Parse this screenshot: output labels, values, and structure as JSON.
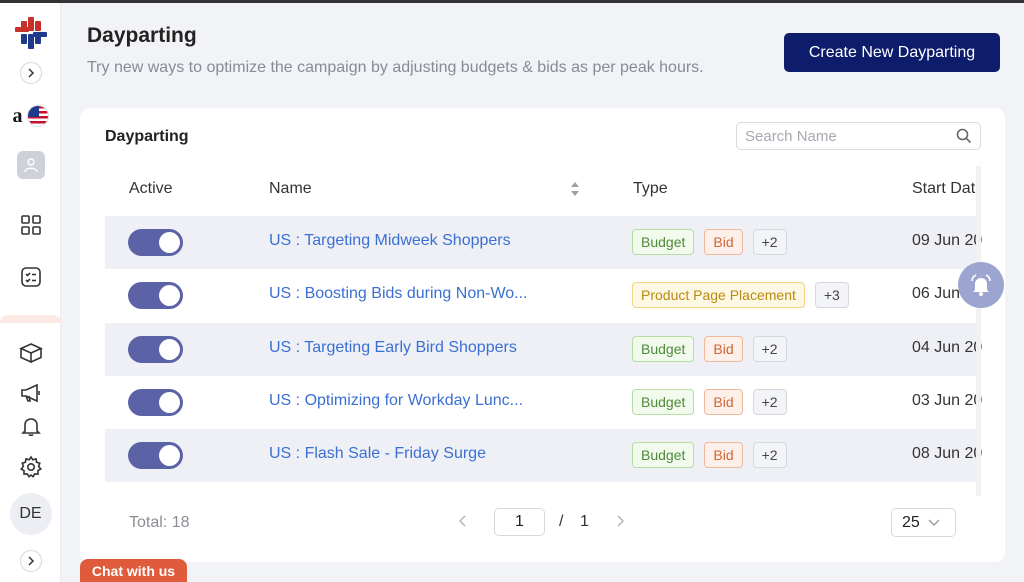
{
  "header": {
    "title": "Dayparting",
    "subtitle": "Try new ways to optimize the campaign by adjusting budgets & bids as per peak hours.",
    "create_button": "Create New Dayparting"
  },
  "sidebar": {
    "marketplace_letter": "a",
    "user_initials": "DE",
    "icons": [
      "logo-icon",
      "expand-icon",
      "amazon-icon",
      "us-flag-icon",
      "user-icon",
      "dashboard-icon",
      "checklist-icon",
      "box-icon",
      "megaphone-icon",
      "bell-icon",
      "gear-icon",
      "expand-icon"
    ]
  },
  "card": {
    "title": "Dayparting",
    "search": {
      "placeholder": "Search Name",
      "value": ""
    }
  },
  "table": {
    "columns": {
      "active": "Active",
      "name": "Name",
      "type": "Type",
      "start_date": "Start Dat"
    },
    "rows": [
      {
        "active": true,
        "name": "US : Targeting Midweek Shoppers",
        "tags": [
          {
            "label": "Budget",
            "kind": "budget"
          },
          {
            "label": "Bid",
            "kind": "bid"
          },
          {
            "label": "+2",
            "kind": "more"
          }
        ],
        "start_date": "09 Jun 20"
      },
      {
        "active": true,
        "name": "US : Boosting Bids during Non-Wo...",
        "tags": [
          {
            "label": "Product Page Placement",
            "kind": "placement"
          },
          {
            "label": "+3",
            "kind": "more"
          }
        ],
        "start_date": "06 Jun 20"
      },
      {
        "active": true,
        "name": "US : Targeting Early Bird Shoppers",
        "tags": [
          {
            "label": "Budget",
            "kind": "budget"
          },
          {
            "label": "Bid",
            "kind": "bid"
          },
          {
            "label": "+2",
            "kind": "more"
          }
        ],
        "start_date": "04 Jun 20"
      },
      {
        "active": true,
        "name": "US : Optimizing for Workday Lunc...",
        "tags": [
          {
            "label": "Budget",
            "kind": "budget"
          },
          {
            "label": "Bid",
            "kind": "bid"
          },
          {
            "label": "+2",
            "kind": "more"
          }
        ],
        "start_date": "03 Jun 20"
      },
      {
        "active": true,
        "name": "US : Flash Sale - Friday Surge",
        "tags": [
          {
            "label": "Budget",
            "kind": "budget"
          },
          {
            "label": "Bid",
            "kind": "bid"
          },
          {
            "label": "+2",
            "kind": "more"
          }
        ],
        "start_date": "08 Jun 20"
      }
    ]
  },
  "footer": {
    "total": "Total: 18",
    "current_page": "1",
    "separator": "/",
    "total_pages": "1",
    "per_page": "25"
  },
  "chat": {
    "label": "Chat with us"
  },
  "colors": {
    "primary_button": "#0e1d6b",
    "toggle_on": "#5b63a6",
    "link": "#3b6fd4",
    "chat": "#e05a3c"
  }
}
